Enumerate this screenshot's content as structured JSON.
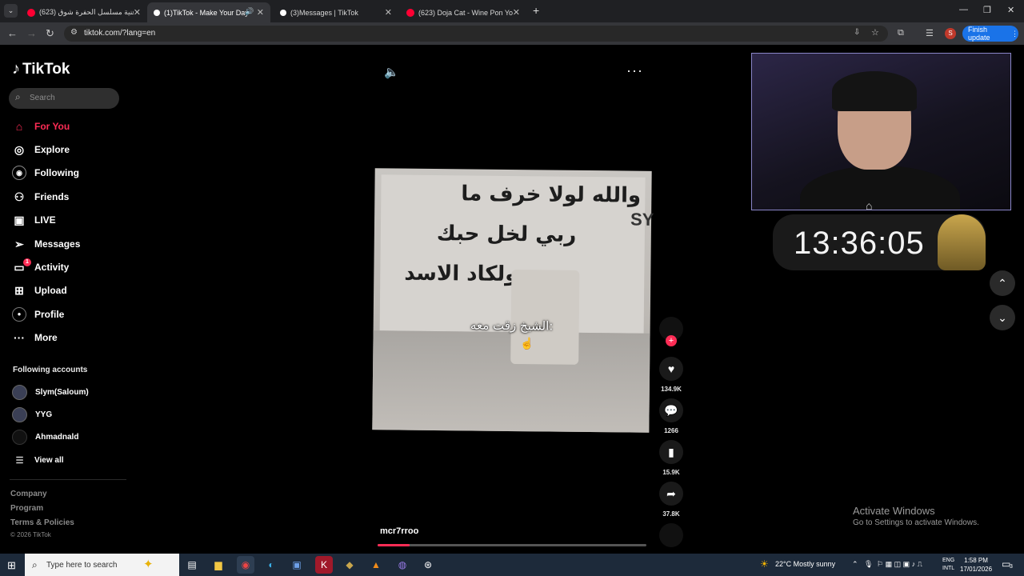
{
  "browser": {
    "tabs": [
      {
        "title": "اغنية مسلسل الحفرة شوق (623)",
        "active": false,
        "favicon_color": "#ff0033"
      },
      {
        "title": "(1)TikTok - Make Your Day",
        "active": true,
        "favicon_color": "#ffffff"
      },
      {
        "title": "(3)Messages | TikTok",
        "active": false,
        "favicon_color": "#ffffff"
      },
      {
        "title": "(623) Doja Cat - Wine Pon You",
        "active": false,
        "favicon_color": "#ff0033"
      }
    ],
    "new_tab": "+",
    "url": "tiktok.com/?lang=en",
    "finish_update": "Finish update",
    "profile_initial": "S"
  },
  "sidebar": {
    "logo": "TikTok",
    "search_placeholder": "Search",
    "nav": [
      {
        "label": "For You",
        "icon": "home-icon",
        "selected": true
      },
      {
        "label": "Explore",
        "icon": "compass-icon"
      },
      {
        "label": "Following",
        "icon": "following-icon"
      },
      {
        "label": "Friends",
        "icon": "friends-icon"
      },
      {
        "label": "LIVE",
        "icon": "live-icon"
      },
      {
        "label": "Messages",
        "icon": "messages-icon"
      },
      {
        "label": "Activity",
        "icon": "activity-icon",
        "badge": "1"
      },
      {
        "label": "Upload",
        "icon": "upload-icon"
      },
      {
        "label": "Profile",
        "icon": "profile-icon"
      },
      {
        "label": "More",
        "icon": "more-icon"
      }
    ],
    "following_header": "Following accounts",
    "accounts": [
      "Slym(Saloum)",
      "YYG",
      "Ahmadnald"
    ],
    "view_all": "View all",
    "footer": [
      "Company",
      "Program",
      "Terms & Policies"
    ],
    "copyright": "© 2026 TikTok"
  },
  "video": {
    "caption": "الشيخ زقت معه:",
    "graffiti": [
      "والله لولا خرف ما",
      "ربي لخل حبك",
      "ولكاد الاسد"
    ],
    "username": "mcr7rroo",
    "progress": 0.12,
    "likes": "134.9K",
    "comments": "1266",
    "saves": "15.9K",
    "shares": "37.8K"
  },
  "overlay": {
    "clock": "13:36:05"
  },
  "windows": {
    "activate_title": "Activate Windows",
    "activate_sub": "Go to Settings to activate Windows.",
    "taskbar_search": "Type here to search",
    "weather": "22°C  Mostly sunny",
    "lang": "ENG",
    "layout": "INTL",
    "time": "1:58 PM",
    "date": "17/01/2026",
    "notif_count": "3"
  }
}
